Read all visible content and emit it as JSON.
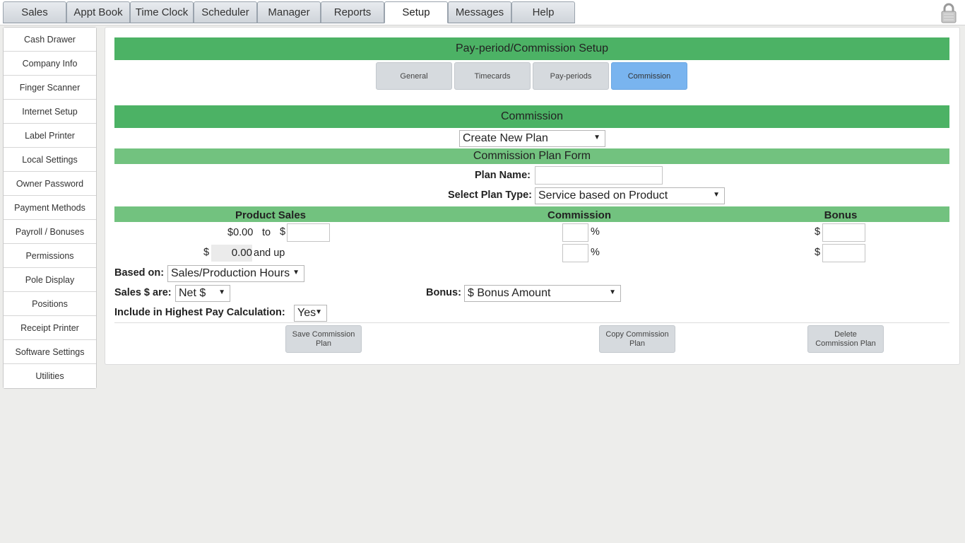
{
  "topnav": {
    "tabs": [
      "Sales",
      "Appt Book",
      "Time Clock",
      "Scheduler",
      "Manager",
      "Reports",
      "Setup",
      "Messages",
      "Help"
    ],
    "active_tab": "Setup"
  },
  "sidebar": {
    "items": [
      "Cash Drawer",
      "Company Info",
      "Finger Scanner",
      "Internet Setup",
      "Label Printer",
      "Local Settings",
      "Owner Password",
      "Payment Methods",
      "Payroll / Bonuses",
      "Permissions",
      "Pole Display",
      "Positions",
      "Receipt Printer",
      "Software Settings",
      "Utilities"
    ]
  },
  "main": {
    "title": "Pay-period/Commission Setup",
    "subtabs": [
      "General",
      "Timecards",
      "Pay-periods",
      "Commission"
    ],
    "active_subtab": "Commission",
    "section_title": "Commission",
    "plan_select": "Create New Plan",
    "form_title": "Commission Plan Form",
    "plan_name_label": "Plan Name:",
    "plan_name_value": "",
    "plan_type_label": "Select Plan Type:",
    "plan_type_value": "Service based on Product",
    "columns": {
      "product_sales": "Product Sales",
      "commission": "Commission",
      "bonus": "Bonus"
    },
    "tiers": {
      "row1_from": "$0.00",
      "row1_to_label": "to",
      "currency_symbol": "$",
      "percent_symbol": "%",
      "row2_from": "0.00",
      "row2_suffix": "and up"
    },
    "based_on_label": "Based on:",
    "based_on_value": "Sales/Production Hours",
    "sales_are_label": "Sales $ are:",
    "sales_are_value": "Net $",
    "bonus_label": "Bonus:",
    "bonus_value": "$ Bonus Amount",
    "include_label": "Include in Highest Pay Calculation:",
    "include_value": "Yes",
    "buttons": {
      "save": "Save Commission Plan",
      "copy": "Copy Commission Plan",
      "delete": "Delete Commission Plan"
    }
  },
  "colors": {
    "header_green": "#4cb265",
    "light_green": "#72c27f",
    "active_subtab_blue": "#79b4ef"
  },
  "icons": {
    "lock": "lock-icon",
    "dropdown": "chevron-down-icon"
  }
}
